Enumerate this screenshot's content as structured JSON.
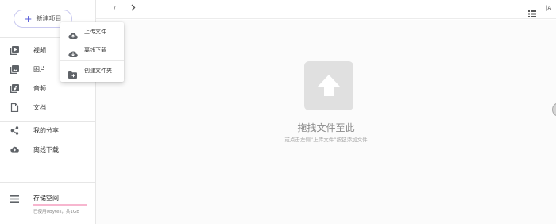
{
  "sidebar": {
    "new_button": {
      "plus": "+",
      "label": "新建项目"
    },
    "nav": [
      {
        "label": "视频",
        "icon": "video-icon"
      },
      {
        "label": "图片",
        "icon": "image-icon"
      },
      {
        "label": "音频",
        "icon": "audio-icon"
      },
      {
        "label": "文档",
        "icon": "document-icon"
      },
      {
        "label": "我的分享",
        "icon": "share-icon"
      },
      {
        "label": "离线下载",
        "icon": "cloud-download-icon"
      }
    ],
    "storage": {
      "title": "存储空间",
      "info": "已使用0Bytes，共1GB",
      "used_fraction": 0.0,
      "icon": "storage-icon"
    }
  },
  "topbar": {
    "breadcrumb_root": "/",
    "next_icon": "chevron-right-icon",
    "view_icon": "list-view-icon",
    "sort_label": "|A"
  },
  "main": {
    "drop_icon": "upload-arrow-icon",
    "drop_title": "拖拽文件至此",
    "drop_hint": "或点击左侧“上传文件”按钮添加文件"
  },
  "menu": {
    "items": [
      {
        "label": "上传文件",
        "icon": "cloud-upload-icon"
      },
      {
        "label": "离线下载",
        "icon": "cloud-download-icon"
      },
      {
        "label": "创建文件夹",
        "icon": "new-folder-icon"
      }
    ]
  },
  "colors": {
    "accent": "#5a5fd8",
    "storage_bar": "#ef5f97",
    "icon_grey": "#5f6368"
  }
}
